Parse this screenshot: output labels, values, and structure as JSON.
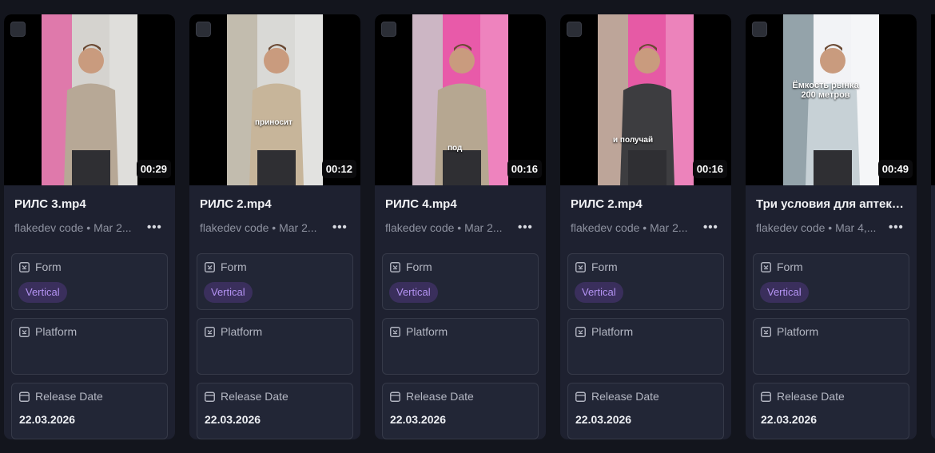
{
  "labels": {
    "form": "Form",
    "platform": "Platform",
    "release_date": "Release Date"
  },
  "colors": {
    "background": "#13151d",
    "card": "#1e2130",
    "tag_bg": "#3a2f5c",
    "tag_text": "#b493f3"
  },
  "cards": [
    {
      "title": "РИЛС 3.mp4",
      "meta": "flakedev code • Mar 2...",
      "duration": "00:29",
      "form_value": "Vertical",
      "release_date": "22.03.2026",
      "overlay_text": "",
      "thumb_colors": [
        "#d5d3cf",
        "#e06fa6",
        "#b7a896"
      ]
    },
    {
      "title": "РИЛС 2.mp4",
      "meta": "flakedev code • Mar 2...",
      "duration": "00:12",
      "form_value": "Vertical",
      "release_date": "22.03.2026",
      "overlay_text": "приносит",
      "thumb_colors": [
        "#d9d9d6",
        "#bfb8aa",
        "#c7b59a"
      ]
    },
    {
      "title": "РИЛС 4.mp4",
      "meta": "flakedev code • Mar 2...",
      "duration": "00:16",
      "form_value": "Vertical",
      "release_date": "22.03.2026",
      "overlay_text": "под",
      "thumb_colors": [
        "#e85aa9",
        "#c9c0c6",
        "#b6a791"
      ]
    },
    {
      "title": "РИЛС 2.mp4",
      "meta": "flakedev code • Mar 2...",
      "duration": "00:16",
      "form_value": "Vertical",
      "release_date": "22.03.2026",
      "overlay_text": "и получай",
      "thumb_colors": [
        "#e65aa5",
        "#b8ad98",
        "#3d3d40"
      ]
    },
    {
      "title": "Три условия для аптеки...",
      "meta": "flakedev code • Mar 4,...",
      "duration": "00:49",
      "form_value": "Vertical",
      "release_date": "22.03.2026",
      "overlay_text": "Ёмкость рынка 200 метров",
      "thumb_colors": [
        "#f2f3f6",
        "#8a9aa2",
        "#c7d1d6"
      ]
    }
  ]
}
